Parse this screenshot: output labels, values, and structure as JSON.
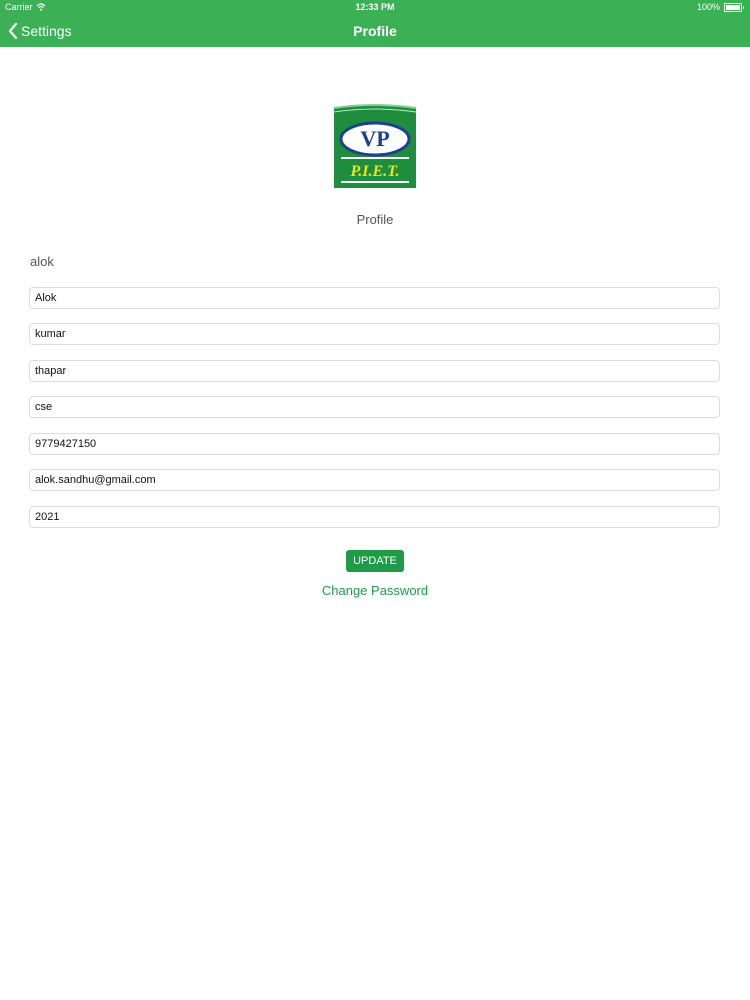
{
  "status_bar": {
    "carrier": "Carrier",
    "time": "12:33 PM",
    "battery": "100%"
  },
  "nav": {
    "back_label": "Settings",
    "title": "Profile"
  },
  "logo": {
    "letters": "VP",
    "name": "P.I.E.T."
  },
  "profile": {
    "caption": "Profile",
    "username": "alok",
    "fields": {
      "first_name": "Alok",
      "middle_name": "kumar",
      "last_name": "thapar",
      "branch": "cse",
      "phone": "9779427150",
      "email": "alok.sandhu@gmail.com",
      "year": "2021"
    },
    "update_label": "UPDATE",
    "change_password_label": "Change Password"
  },
  "colors": {
    "accent": "#3cb054",
    "button": "#1e9b46",
    "logo_blue": "#1f3f8f",
    "logo_yellow": "#f2e21b"
  }
}
